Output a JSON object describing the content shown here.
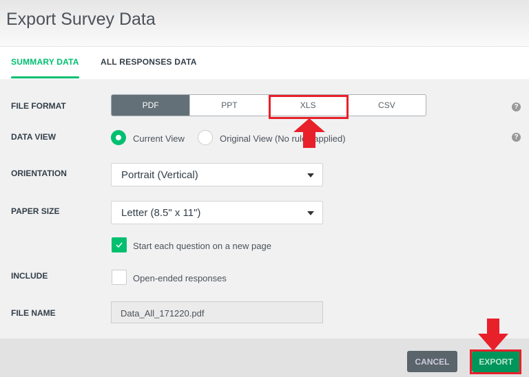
{
  "header": {
    "title": "Export Survey Data"
  },
  "tabs": [
    {
      "label": "SUMMARY DATA",
      "active": true
    },
    {
      "label": "ALL RESPONSES DATA",
      "active": false
    }
  ],
  "form": {
    "file_format": {
      "label": "FILE FORMAT",
      "options": [
        "PDF",
        "PPT",
        "XLS",
        "CSV"
      ],
      "selected": "PDF"
    },
    "data_view": {
      "label": "DATA VIEW",
      "options": [
        "Current View",
        "Original View (No rules applied)"
      ],
      "selected": "Current View"
    },
    "orientation": {
      "label": "ORIENTATION",
      "value": "Portrait (Vertical)"
    },
    "paper_size": {
      "label": "PAPER SIZE",
      "value": "Letter (8.5\" x 11\")"
    },
    "new_page": {
      "label": "Start each question on a new page",
      "checked": true
    },
    "include": {
      "label": "INCLUDE",
      "option": "Open-ended responses",
      "checked": false
    },
    "file_name": {
      "label": "FILE NAME",
      "value": "Data_All_171220.pdf"
    },
    "help": "?"
  },
  "footer": {
    "cancel": "CANCEL",
    "export": "EXPORT"
  },
  "colors": {
    "accent": "#00bf6f",
    "annotation": "#e8202a",
    "selected_segment": "#637078"
  }
}
